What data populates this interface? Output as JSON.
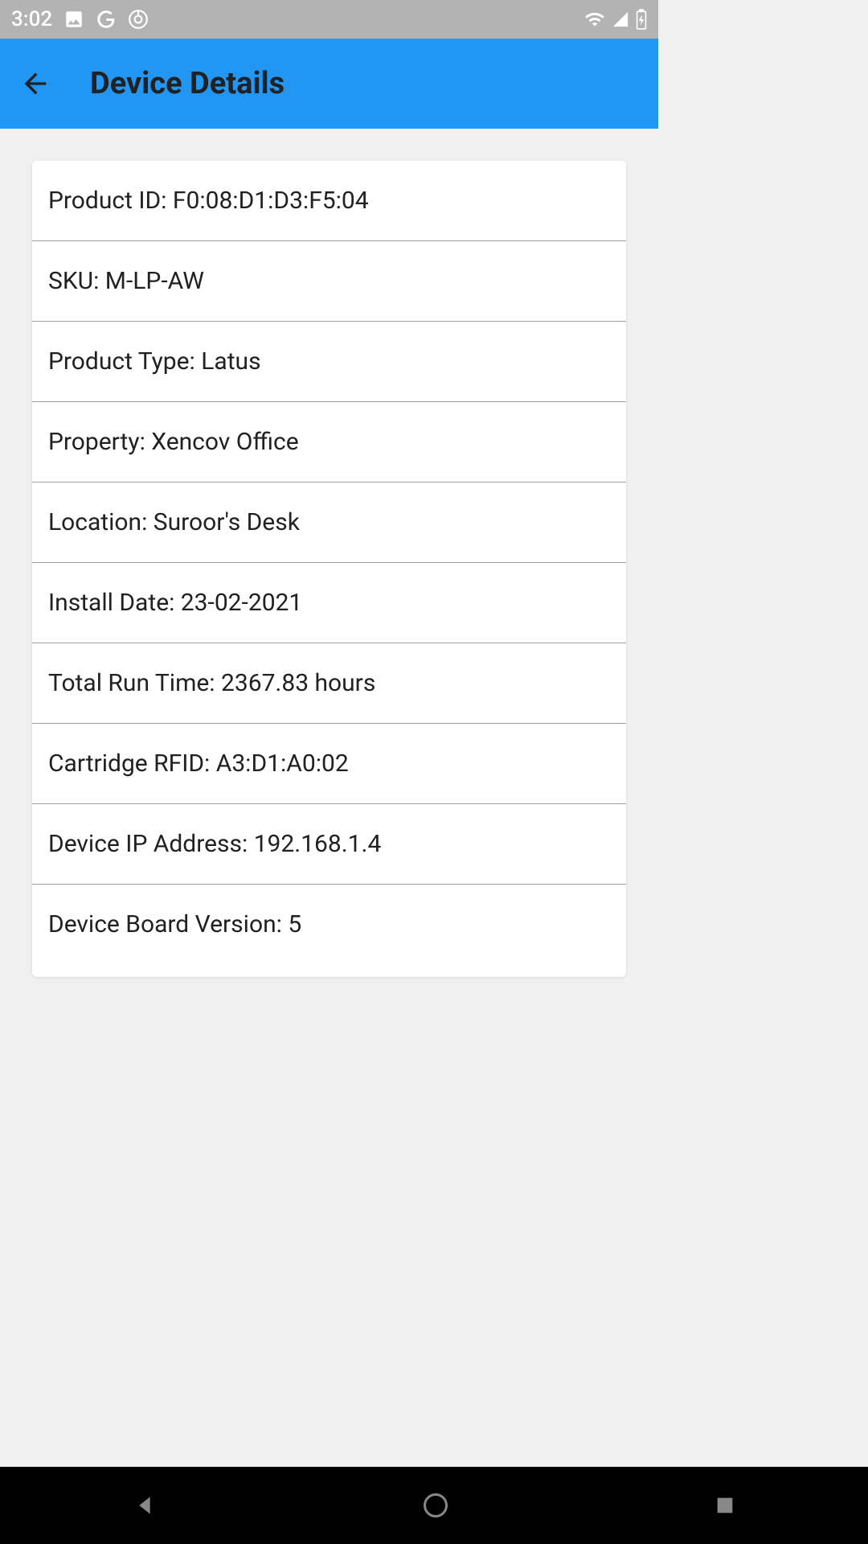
{
  "status_bar": {
    "time": "3:02"
  },
  "header": {
    "title": "Device Details"
  },
  "details": [
    "Product ID: F0:08:D1:D3:F5:04",
    "SKU: M-LP-AW",
    "Product Type: Latus",
    "Property: Xencov Office",
    "Location: Suroor's Desk",
    "Install Date: 23-02-2021",
    "Total Run Time: 2367.83 hours",
    "Cartridge RFID: A3:D1:A0:02",
    "Device IP Address: 192.168.1.4",
    "Device Board Version: 5"
  ]
}
